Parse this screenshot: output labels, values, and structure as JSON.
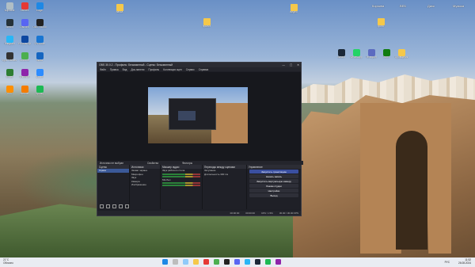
{
  "desktop": {
    "left_icons": [
      {
        "label": "Корзина",
        "color": "#b0bec5"
      },
      {
        "label": "Yandex",
        "color": "#e53935"
      },
      {
        "label": "Edge",
        "color": "#1e88e5"
      },
      {
        "label": "Steam",
        "color": "#263238"
      },
      {
        "label": "Discord",
        "color": "#5865f2"
      },
      {
        "label": "OBS Studio",
        "color": "#222222"
      },
      {
        "label": "Telegram",
        "color": "#29b6f6"
      },
      {
        "label": "Photoshop",
        "color": "#0d47a1"
      },
      {
        "label": "VS Code",
        "color": "#1976d2"
      },
      {
        "label": "Epic Games",
        "color": "#333333"
      },
      {
        "label": "Chrome",
        "color": "#4caf50"
      },
      {
        "label": "Word",
        "color": "#1565c0"
      },
      {
        "label": "Excel",
        "color": "#2e7d32"
      },
      {
        "label": "WinRAR",
        "color": "#8e24aa"
      },
      {
        "label": "Zoom",
        "color": "#2d8cff"
      },
      {
        "label": "VLC",
        "color": "#ff8f00"
      },
      {
        "label": "Blender",
        "color": "#f57c00"
      },
      {
        "label": "Spotify",
        "color": "#1db954"
      }
    ],
    "top_folders": [
      {
        "label": "папка"
      },
      {
        "label": "проект"
      },
      {
        "label": "видео"
      },
      {
        "label": "фото"
      }
    ],
    "right_icons": [
      {
        "label": "Steam",
        "color": "#1b2838"
      },
      {
        "label": "WhatsApp",
        "color": "#25d366"
      },
      {
        "label": "Телефон",
        "color": "#5c6bc0"
      },
      {
        "label": "Xbox",
        "color": "#107c10"
      },
      {
        "label": "Проводник",
        "color": "#f5c84a"
      }
    ],
    "sys_labels": [
      "Корзина",
      "ВЕБ",
      "Диск",
      "Музыка"
    ]
  },
  "obs": {
    "title": "OBS 30.0.2 - Профиль: Безымянный - Сцены: Безымянный",
    "menu": [
      "Файл",
      "Правка",
      "Вид",
      "Док-панели",
      "Профиль",
      "Коллекция сцен",
      "Сервис",
      "Справка"
    ],
    "controls_label": "Источник не выбран",
    "controls_extra": [
      "Свойства",
      "Фильтры"
    ],
    "docks": {
      "scenes_title": "Сцены",
      "scenes": [
        "Сцена"
      ],
      "sources_title": "Источники",
      "sources": [
        "Захват экрана",
        "Микрофон",
        "Звук",
        "Камера",
        "Изображение"
      ],
      "mixer_title": "Микшер аудио",
      "mixer": [
        "Звук рабочего стола",
        "Mic/Aux"
      ],
      "transitions_title": "Переходы между сценами",
      "transitions": [
        "Затухание",
        "Длительность 300 ms"
      ],
      "controls_title": "Управление",
      "controls": [
        "Запустить трансляцию",
        "Начать запись",
        "Запустить виртуальную камеру",
        "Режим студии",
        "Настройки",
        "Выход"
      ]
    },
    "status": [
      "00:00:00",
      "00:00:00",
      "CPU: 1.5%",
      "30.00 / 30.00 FPS"
    ]
  },
  "taskbar": {
    "weather": "21°C",
    "weather_desc": "Облачно",
    "time": "11:52",
    "date": "26.08.2024",
    "lang": "РУС"
  }
}
